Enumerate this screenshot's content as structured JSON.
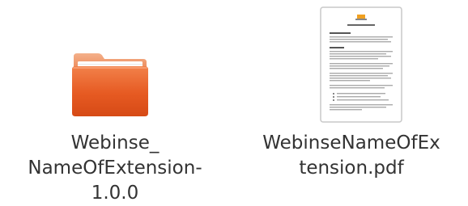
{
  "files": [
    {
      "type": "folder",
      "icon": "folder-icon",
      "name_lines": [
        "Webinse_",
        "NameOfExtension-",
        "1.0.0"
      ]
    },
    {
      "type": "pdf",
      "icon": "pdf-document-icon",
      "name_lines": [
        "WebinseNameOfEx",
        "tension.pdf"
      ]
    }
  ],
  "colors": {
    "folder_body": "#e8602a",
    "folder_top": "#f29d6e",
    "folder_paper": "#ffffff",
    "label_text": "#333333"
  }
}
